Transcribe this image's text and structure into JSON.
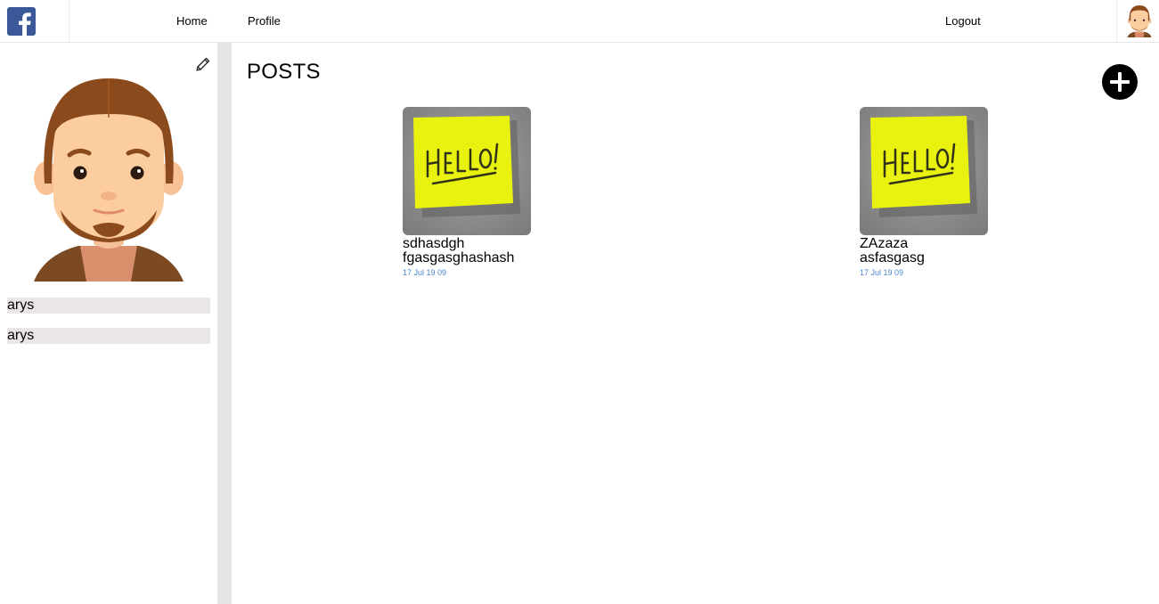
{
  "header": {
    "nav": {
      "home": "Home",
      "profile": "Profile",
      "logout": "Logout"
    },
    "brand_color": "#3b5998"
  },
  "sidebar": {
    "fields": [
      {
        "value": "arys"
      },
      {
        "value": "arys"
      }
    ]
  },
  "main": {
    "title": "POSTS",
    "posts": [
      {
        "title": "sdhasdgh",
        "body": "fgasgasghashash",
        "date": "17 Jul 19 09"
      },
      {
        "title": "ZAzaza",
        "body": "asfasgasg",
        "date": "17 Jul 19 09"
      }
    ]
  },
  "colors": {
    "date_link": "#4a86c9",
    "field_bg": "#ebe6e6",
    "divider": "#e5e5e5"
  },
  "icons": {
    "logo": "facebook-logo",
    "edit": "pencil-icon",
    "add": "plus-circle-icon"
  }
}
